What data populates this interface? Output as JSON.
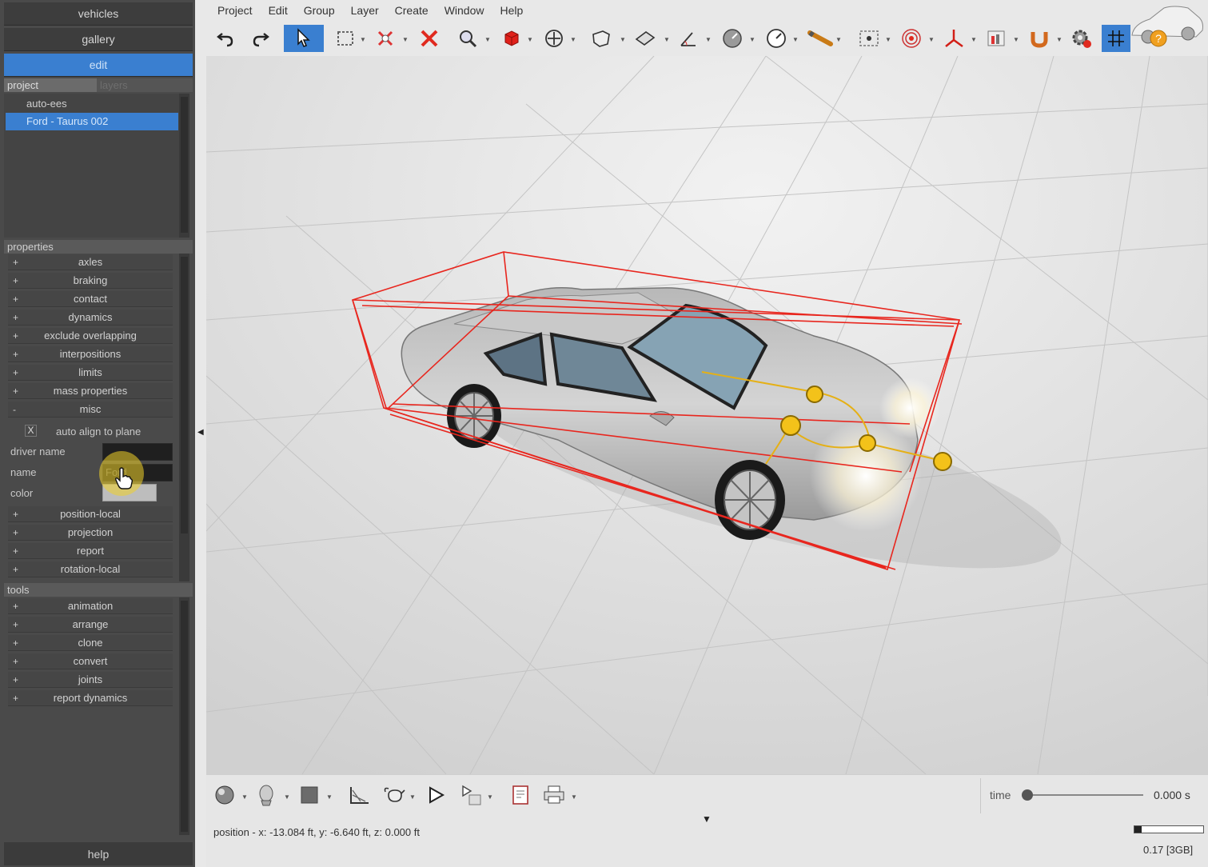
{
  "left": {
    "nav": [
      "vehicles",
      "gallery",
      "edit"
    ],
    "project_tabs": [
      "project",
      "layers"
    ],
    "project_items": [
      "auto-ees",
      "Ford - Taurus 002"
    ],
    "properties_header": "properties",
    "properties": [
      {
        "sign": "+",
        "label": "axles"
      },
      {
        "sign": "+",
        "label": "braking"
      },
      {
        "sign": "+",
        "label": "contact"
      },
      {
        "sign": "+",
        "label": "dynamics"
      },
      {
        "sign": "+",
        "label": "exclude overlapping"
      },
      {
        "sign": "+",
        "label": "interpositions"
      },
      {
        "sign": "+",
        "label": "limits"
      },
      {
        "sign": "+",
        "label": "mass properties"
      },
      {
        "sign": "-",
        "label": "misc"
      }
    ],
    "misc": {
      "auto_align_label": "auto align to plane",
      "checkbox_mark": "X",
      "driver_name_label": "driver name",
      "name_label": "name",
      "name_value": "Ford",
      "color_label": "color"
    },
    "properties_more": [
      {
        "sign": "+",
        "label": "position-local"
      },
      {
        "sign": "+",
        "label": "projection"
      },
      {
        "sign": "+",
        "label": "report"
      },
      {
        "sign": "+",
        "label": "rotation-local"
      }
    ],
    "tools_header": "tools",
    "tools": [
      {
        "sign": "+",
        "label": "animation"
      },
      {
        "sign": "+",
        "label": "arrange"
      },
      {
        "sign": "+",
        "label": "clone"
      },
      {
        "sign": "+",
        "label": "convert"
      },
      {
        "sign": "+",
        "label": "joints"
      },
      {
        "sign": "+",
        "label": "report dynamics"
      }
    ],
    "help": "help"
  },
  "menu": [
    "Project",
    "Edit",
    "Group",
    "Layer",
    "Create",
    "Window",
    "Help"
  ],
  "toolbar_icons": [
    "undo-icon",
    "redo-icon",
    "select-arrow-icon",
    "rectangle-select-icon",
    "pin-icon",
    "delete-icon",
    "zoom-icon",
    "cube-icon",
    "move-icon",
    "box-wire-icon",
    "plane-icon",
    "measure-angle-icon",
    "dial-icon",
    "gauge-icon",
    "pencil-tool-icon",
    "camera-target-icon",
    "target-icon",
    "axis-icon",
    "chart-icon",
    "magnet-icon",
    "gear-icon",
    "grid-icon",
    "help-icon"
  ],
  "bottom": {
    "status": "position - x: -13.084 ft, y: -6.640 ft, z: 0.000 ft",
    "time_label": "time",
    "time_value": "0.000 s",
    "memory": "0.17 [3GB]",
    "memory_fraction": 0.1,
    "time_fraction": 0.0
  },
  "colors": {
    "accent": "#3a7fd0",
    "bounding_box": "#e8261e",
    "joint_marker": "#f0b400"
  }
}
